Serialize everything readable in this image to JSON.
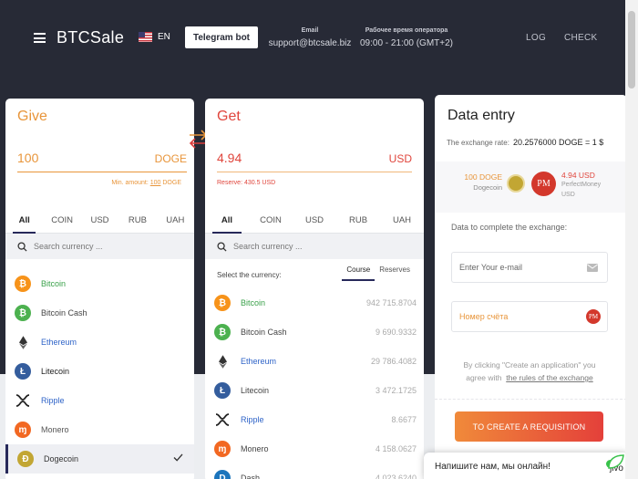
{
  "header": {
    "logo": "BTCSale",
    "lang": "EN",
    "telegram_button": "Telegram bot",
    "email_label": "Email",
    "email_value": "support@btcsale.biz",
    "hours_label": "Рабочее время оператора",
    "hours_value": "09:00 - 21:00 (GMT+2)",
    "nav": [
      "LOG",
      "CHECK"
    ]
  },
  "give": {
    "title": "Give",
    "amount": "100",
    "currency": "DOGE",
    "min_label": "Min. amount:",
    "min_value": "100",
    "min_currency": "DOGE",
    "tabs": [
      "All",
      "COIN",
      "USD",
      "RUB",
      "UAH"
    ],
    "search_placeholder": "Search currency ...",
    "items": [
      {
        "name": "Bitcoin",
        "icon": "bitcoin-icon",
        "color": "#f7931a"
      },
      {
        "name": "Bitcoin Cash",
        "icon": "bitcoin-cash-icon",
        "color": "#4cb14f"
      },
      {
        "name": "Ethereum",
        "icon": "ethereum-icon",
        "color": "#333333"
      },
      {
        "name": "Litecoin",
        "icon": "litecoin-icon",
        "color": "#345d9d"
      },
      {
        "name": "Ripple",
        "icon": "ripple-icon",
        "color": "#222222"
      },
      {
        "name": "Monero",
        "icon": "monero-icon",
        "color": "#f26822"
      },
      {
        "name": "Dogecoin",
        "icon": "dogecoin-icon",
        "color": "#c2a633"
      }
    ]
  },
  "get": {
    "title": "Get",
    "amount": "4.94",
    "currency": "USD",
    "reserve_label": "Reserve: 430.5 USD",
    "tabs": [
      "All",
      "COIN",
      "USD",
      "RUB",
      "UAH"
    ],
    "search_placeholder": "Search currency ...",
    "select_label": "Select the currency:",
    "subtabs": [
      "Course",
      "Reserves"
    ],
    "items": [
      {
        "name": "Bitcoin",
        "reserve": "942 715.8704"
      },
      {
        "name": "Bitcoin Cash",
        "reserve": "9 690.9332"
      },
      {
        "name": "Ethereum",
        "reserve": "29 786.4082"
      },
      {
        "name": "Litecoin",
        "reserve": "3 472.1725"
      },
      {
        "name": "Ripple",
        "reserve": "8.6677"
      },
      {
        "name": "Monero",
        "reserve": "4 158.0627"
      },
      {
        "name": "Dash",
        "reserve": "4 023.6240"
      }
    ]
  },
  "entry": {
    "title": "Data entry",
    "rate_label": "The exchange rate:",
    "rate_value": "20.2576000 DOGE = 1 $",
    "give_amount": "100 DOGE",
    "give_name": "Dogecoin",
    "get_amount": "4.94 USD",
    "get_name_1": "PerfectMoney",
    "get_name_2": "USD",
    "complete_label": "Data to complete the exchange:",
    "email_placeholder": "Enter Your e-mail",
    "account_placeholder": "Номер счёта",
    "agree_1": "By clicking \"Create an application\" you",
    "agree_2": "agree with",
    "agree_link": "the rules of the exchange",
    "cta": "TO CREATE A REQUISITION"
  },
  "chat": {
    "text": "Напишите нам, мы онлайн!",
    "brand": "jivo"
  }
}
